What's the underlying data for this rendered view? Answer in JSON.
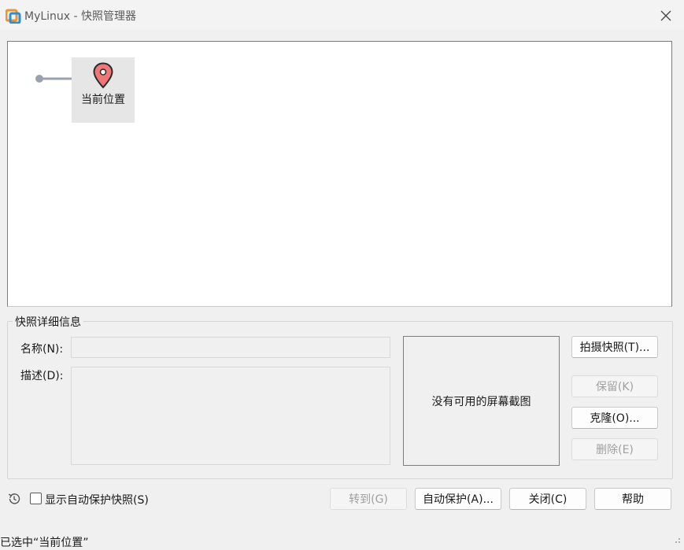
{
  "window": {
    "title": "MyLinux - 快照管理器"
  },
  "tree": {
    "current_label": "当前位置"
  },
  "details": {
    "group_title": "快照详细信息",
    "name_label": "名称(N):",
    "name_value": "",
    "desc_label": "描述(D):",
    "desc_value": "",
    "no_screenshot": "没有可用的屏幕截图"
  },
  "side_buttons": {
    "take_snapshot": "拍摄快照(T)...",
    "keep": "保留(K)",
    "clone": "克隆(O)...",
    "delete": "删除(E)"
  },
  "bottom": {
    "show_autoprotect_label": "显示自动保护快照(S)",
    "show_autoprotect_checked": false,
    "goto": "转到(G)",
    "autoprotect": "自动保护(A)...",
    "close": "关闭(C)",
    "help": "帮助"
  },
  "status": {
    "text": "已选中“当前位置”"
  },
  "colors": {
    "pin_fill": "#f07777",
    "pin_stroke": "#2b2b2b",
    "tree_line": "#9aa3ad",
    "icon_orange": "#f0932b",
    "icon_blue": "#2d8fd5"
  },
  "icons": {
    "app": "vmware-icon",
    "close": "close-icon",
    "pin": "location-pin-icon",
    "history": "history-icon"
  }
}
